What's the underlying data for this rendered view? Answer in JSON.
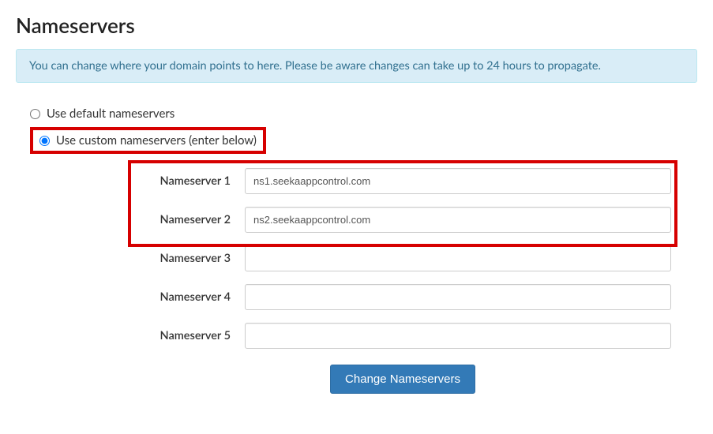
{
  "heading": "Nameservers",
  "info_message": "You can change where your domain points to here. Please be aware changes can take up to 24 hours to propagate.",
  "radios": {
    "default_label": "Use default nameservers",
    "custom_label": "Use custom nameservers (enter below)"
  },
  "fields": [
    {
      "label": "Nameserver 1",
      "value": "ns1.seekaappcontrol.com"
    },
    {
      "label": "Nameserver 2",
      "value": "ns2.seekaappcontrol.com"
    },
    {
      "label": "Nameserver 3",
      "value": ""
    },
    {
      "label": "Nameserver 4",
      "value": ""
    },
    {
      "label": "Nameserver 5",
      "value": ""
    }
  ],
  "submit_label": "Change Nameservers"
}
